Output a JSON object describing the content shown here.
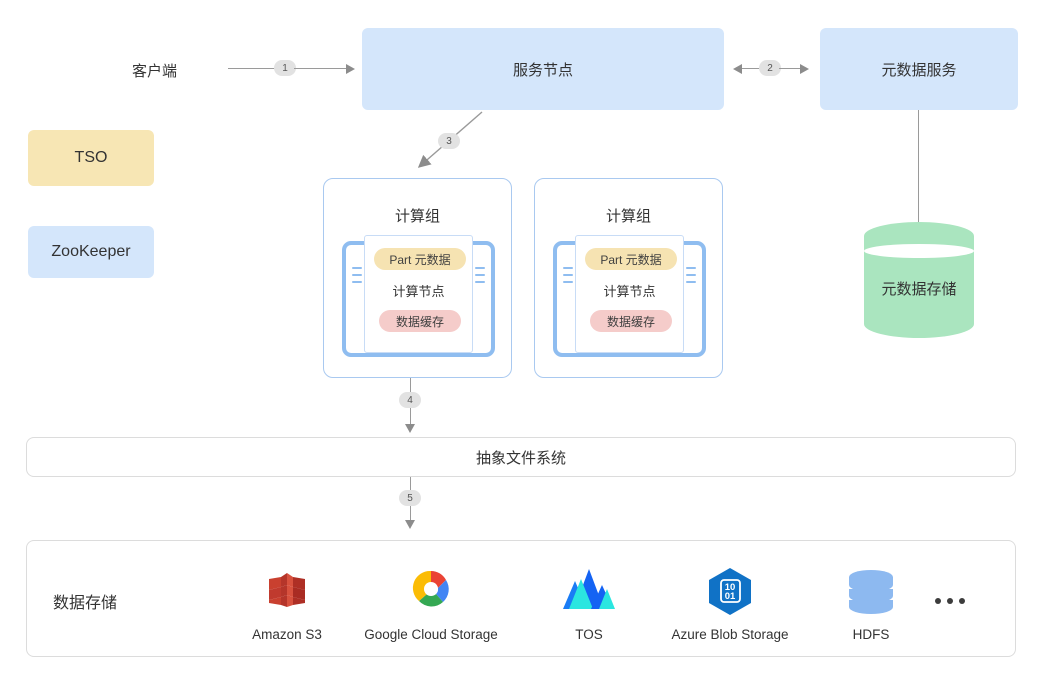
{
  "diagram": {
    "client": {
      "label": "客户端"
    },
    "service_node": {
      "label": "服务节点"
    },
    "metadata_service": {
      "label": "元数据服务"
    },
    "metadata_storage": {
      "label": "元数据存储"
    },
    "tso": {
      "label": "TSO"
    },
    "zookeeper": {
      "label": "ZooKeeper"
    },
    "abstract_fs": {
      "label": "抽象文件系统"
    },
    "data_storage": {
      "label": "数据存储"
    },
    "compute_groups": [
      {
        "title": "计算组",
        "node_title": "计算节点",
        "part_metadata": "Part 元数据",
        "data_cache": "数据缓存"
      },
      {
        "title": "计算组",
        "node_title": "计算节点",
        "part_metadata": "Part 元数据",
        "data_cache": "数据缓存"
      }
    ],
    "flow_badges": [
      {
        "id": "1",
        "label": "1"
      },
      {
        "id": "2",
        "label": "2"
      },
      {
        "id": "3",
        "label": "3"
      },
      {
        "id": "4",
        "label": "4"
      },
      {
        "id": "5",
        "label": "5"
      }
    ],
    "storage_providers": [
      {
        "name": "Amazon S3",
        "icon": "amazon-s3-icon"
      },
      {
        "name": "Google Cloud Storage",
        "icon": "google-cloud-storage-icon"
      },
      {
        "name": "TOS",
        "icon": "tos-icon"
      },
      {
        "name": "Azure Blob Storage",
        "icon": "azure-blob-storage-icon"
      },
      {
        "name": "HDFS",
        "icon": "hdfs-icon"
      }
    ],
    "more_indicator": "…",
    "colors": {
      "box_blue": "#d4e6fb",
      "box_yellow": "#f7e6b4",
      "pill_yellow": "#f6e3b2",
      "pill_red": "#f5ccca",
      "cylinder_green": "#aae5bf",
      "group_border": "#a9c9f0",
      "connector_gray": "#9a9a9a",
      "badge_gray": "#e2e2e2",
      "panel_border": "#dcdcdc"
    }
  }
}
